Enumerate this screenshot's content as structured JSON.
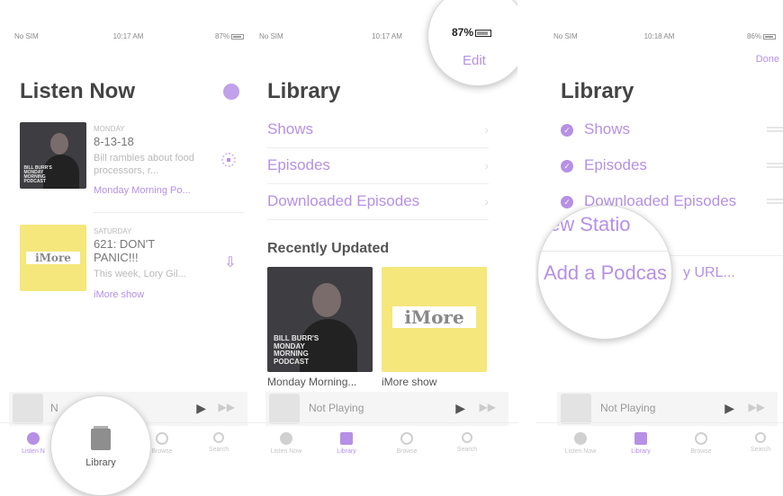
{
  "panel1": {
    "status": {
      "carrier": "No SIM",
      "time": "10:17 AM",
      "battery": "87%"
    },
    "title": "Listen Now",
    "episodes": [
      {
        "day": "MONDAY",
        "title": "8-13-18",
        "desc": "Bill rambles about food processors, r...",
        "show": "Monday Morning Po...",
        "art_caption": "BILL BURR'S\nMONDAY\nMORNING\nPODCAST"
      },
      {
        "day": "SATURDAY",
        "title": "621: DON'T PANIC!!!",
        "desc": "This week, Lory Gil...",
        "show": "iMore show",
        "art_caption": "iMore"
      }
    ],
    "mini_player": {
      "text": "N",
      "play": "▶",
      "ff": "▶▶"
    },
    "tabs": [
      {
        "label": "Listen N"
      },
      {
        "label": "Library"
      },
      {
        "label": "Browse"
      },
      {
        "label": "Search"
      }
    ],
    "magnifier_label": "Library"
  },
  "panel2": {
    "status": {
      "carrier": "No SIM",
      "time": "10:17 AM",
      "battery": "87%"
    },
    "edit_label": "Edit",
    "title": "Library",
    "rows": [
      {
        "label": "Shows"
      },
      {
        "label": "Episodes"
      },
      {
        "label": "Downloaded Episodes"
      }
    ],
    "recent_heading": "Recently Updated",
    "recent": [
      {
        "caption": "Monday Morning...",
        "art_caption": "BILL BURR'S\nMONDAY\nMORNING\nPODCAST"
      },
      {
        "caption": "iMore show",
        "art_caption": "iMore"
      }
    ],
    "mini_player": {
      "text": "Not Playing",
      "play": "▶",
      "ff": "▶▶"
    },
    "tabs": [
      {
        "label": "Listen Now"
      },
      {
        "label": "Library"
      },
      {
        "label": "Browse"
      },
      {
        "label": "Search"
      }
    ]
  },
  "panel3": {
    "status": {
      "carrier": "No SIM",
      "time": "10:18 AM",
      "battery": "86%"
    },
    "done_label": "Done",
    "title": "Library",
    "rows": [
      {
        "label": "Shows"
      },
      {
        "label": "Episodes"
      },
      {
        "label": "Downloaded Episodes"
      }
    ],
    "magnifier_line1": "ew Statio",
    "magnifier_line2": "Add a Podcas",
    "url_suffix": "y URL...",
    "mini_player": {
      "text": "Not Playing",
      "play": "▶",
      "ff": "▶▶"
    },
    "tabs": [
      {
        "label": "Listen Now"
      },
      {
        "label": "Library"
      },
      {
        "label": "Browse"
      },
      {
        "label": "Search"
      }
    ]
  },
  "colors": {
    "accent": "#b690e6",
    "muted": "#b9b9b9",
    "imore_yellow": "#f5e77c",
    "podcast_dark": "#3e3e42"
  }
}
